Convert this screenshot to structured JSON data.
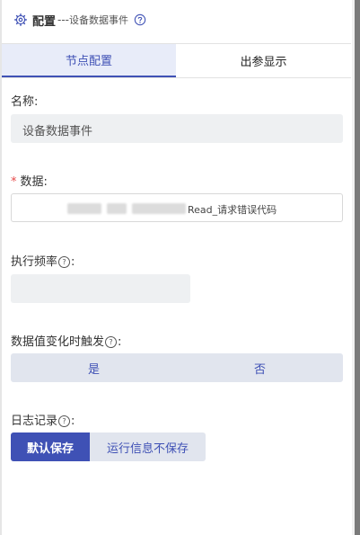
{
  "header": {
    "title": "配置",
    "dashes": "---",
    "subtitle": "设备数据事件"
  },
  "tabs": [
    {
      "label": "节点配置",
      "active": true
    },
    {
      "label": "出参显示",
      "active": false
    }
  ],
  "form": {
    "name_label": "名称:",
    "name_value": "设备数据事件",
    "data_required_mark": "*",
    "data_label": "数据:",
    "data_value_suffix": "Read_请求错误代码",
    "frequency_label": "执行频率",
    "frequency_value": "",
    "trigger_label": "数据值变化时触发",
    "trigger_options": [
      "是",
      "否"
    ],
    "log_label": "日志记录",
    "log_options": [
      "默认保存",
      "运行信息不保存"
    ],
    "log_selected": "默认保存",
    "colon": ":"
  },
  "colors": {
    "accent": "#3f51b5",
    "tab_active_bg": "#e8ecf9",
    "field_bg": "#eef0f2",
    "segment_bg": "#e1e5ee",
    "required": "#e64a4a"
  }
}
